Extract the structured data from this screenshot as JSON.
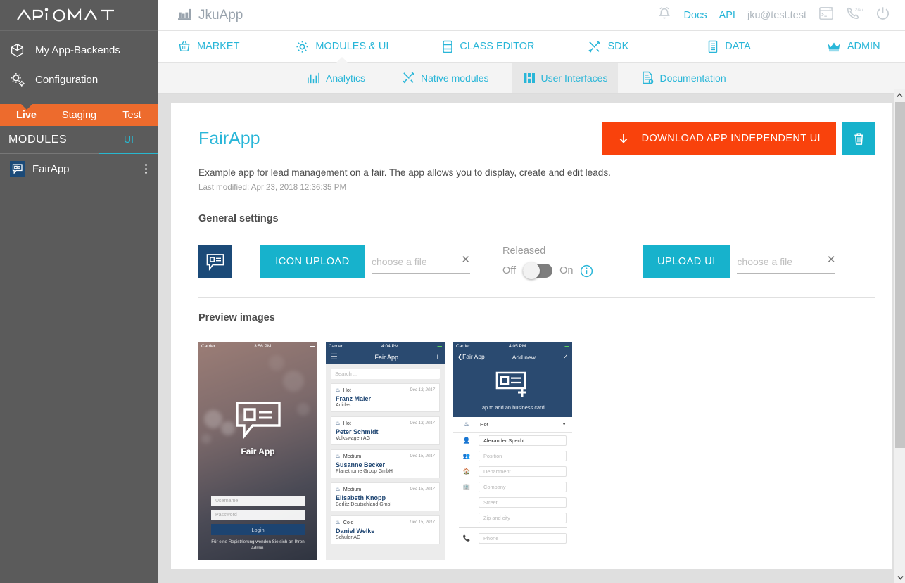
{
  "brand": {
    "name": "APiOMAT"
  },
  "sidebar": {
    "nav": [
      {
        "label": "My App-Backends",
        "icon": "cube-icon"
      },
      {
        "label": "Configuration",
        "icon": "gears-icon"
      }
    ],
    "environments": [
      {
        "label": "Live",
        "active": true
      },
      {
        "label": "Staging",
        "active": false
      },
      {
        "label": "Test",
        "active": false
      }
    ],
    "modules_header": "MODULES",
    "ui_tab": "UI",
    "modules": [
      {
        "name": "FairApp"
      }
    ]
  },
  "topbar": {
    "app_name": "JkuApp",
    "docs": "Docs",
    "api": "API",
    "user": "jku@test.test",
    "icons": [
      "bell-icon",
      "console-icon",
      "support-24-7-icon",
      "power-icon"
    ]
  },
  "mainnav": [
    {
      "label": "MARKET",
      "icon": "basket-icon",
      "active": false
    },
    {
      "label": "MODULES & UI",
      "icon": "gear-icon",
      "active": true
    },
    {
      "label": "CLASS EDITOR",
      "icon": "list-icon",
      "active": false
    },
    {
      "label": "SDK",
      "icon": "tools-icon",
      "active": false
    },
    {
      "label": "DATA",
      "icon": "document-icon",
      "active": false
    },
    {
      "label": "ADMIN",
      "icon": "crown-icon",
      "active": false
    }
  ],
  "subnav": [
    {
      "label": "Analytics",
      "icon": "chart-icon",
      "active": false
    },
    {
      "label": "Native modules",
      "icon": "tools-icon",
      "active": false
    },
    {
      "label": "User Interfaces",
      "icon": "grid-icon",
      "active": true
    },
    {
      "label": "Documentation",
      "icon": "doc-icon",
      "active": false
    }
  ],
  "content": {
    "title": "FairApp",
    "download_button": "DOWNLOAD APP INDEPENDENT UI",
    "delete_button_icon": "trash-icon",
    "description": "Example app for lead management on a fair. The app allows you to display, create and edit leads.",
    "last_modified": "Last modified: Apr 23, 2018 12:36:35 PM",
    "general_settings_title": "General settings",
    "icon_upload_button": "ICON UPLOAD",
    "icon_file_placeholder": "choose a file",
    "icon_file_value": "",
    "released_label": "Released",
    "toggle_off": "Off",
    "toggle_on": "On",
    "toggle_state": "off",
    "upload_ui_button": "UPLOAD UI",
    "ui_file_placeholder": "choose a file",
    "ui_file_value": "",
    "preview_title": "Preview images"
  },
  "previews": {
    "shot1": {
      "carrier": "Carrier",
      "time": "3:56 PM",
      "app_name": "Fair App",
      "username_placeholder": "Username",
      "password_placeholder": "Password",
      "login_button": "Login",
      "hint": "Für eine Registrierung wenden Sie sich an Ihren Admin."
    },
    "shot2": {
      "carrier": "Carrier",
      "time": "4:04 PM",
      "nav_title": "Fair App",
      "search_placeholder": "Search ...",
      "leads": [
        {
          "temp": "Hot",
          "date": "Dec 13, 2017",
          "name": "Franz Maier",
          "company": "Adidas"
        },
        {
          "temp": "Hot",
          "date": "Dec 13, 2017",
          "name": "Peter Schmidt",
          "company": "Volkswagen AG"
        },
        {
          "temp": "Medium",
          "date": "Dec 15, 2017",
          "name": "Susanne Becker",
          "company": "Planethome Group GmbH"
        },
        {
          "temp": "Medium",
          "date": "Dec 15, 2017",
          "name": "Elisabeth Knopp",
          "company": "Berlitz Deutschland GmbH"
        },
        {
          "temp": "Cold",
          "date": "Dec 15, 2017",
          "name": "Daniel Welke",
          "company": "Schuler AG"
        }
      ]
    },
    "shot3": {
      "carrier": "Carrier",
      "time": "4:05 PM",
      "back_label": "Fair App",
      "nav_title": "Add new",
      "hero_text": "Tap to add an business card.",
      "temperature": "Hot",
      "fields": [
        {
          "icon": "person-icon",
          "value": "Alexander Specht",
          "placeholder": "",
          "filled": true
        },
        {
          "icon": "group-icon",
          "value": "",
          "placeholder": "Position",
          "filled": false
        },
        {
          "icon": "home-icon",
          "value": "",
          "placeholder": "Department",
          "filled": false
        },
        {
          "icon": "building-icon",
          "value": "",
          "placeholder": "Company",
          "filled": false
        },
        {
          "icon": "",
          "value": "",
          "placeholder": "Street",
          "filled": false
        },
        {
          "icon": "",
          "value": "",
          "placeholder": "Zip and city",
          "filled": false
        },
        {
          "icon": "phone-icon",
          "value": "",
          "placeholder": "Phone",
          "filled": false
        }
      ]
    }
  },
  "colors": {
    "accent_teal": "#17b2cc",
    "link_cyan": "#29b6d8",
    "orange_env": "#ed6b2d",
    "orange_download": "#f9420c",
    "sidebar_gray": "#5b5b5b",
    "navy": "#2a4a70"
  }
}
